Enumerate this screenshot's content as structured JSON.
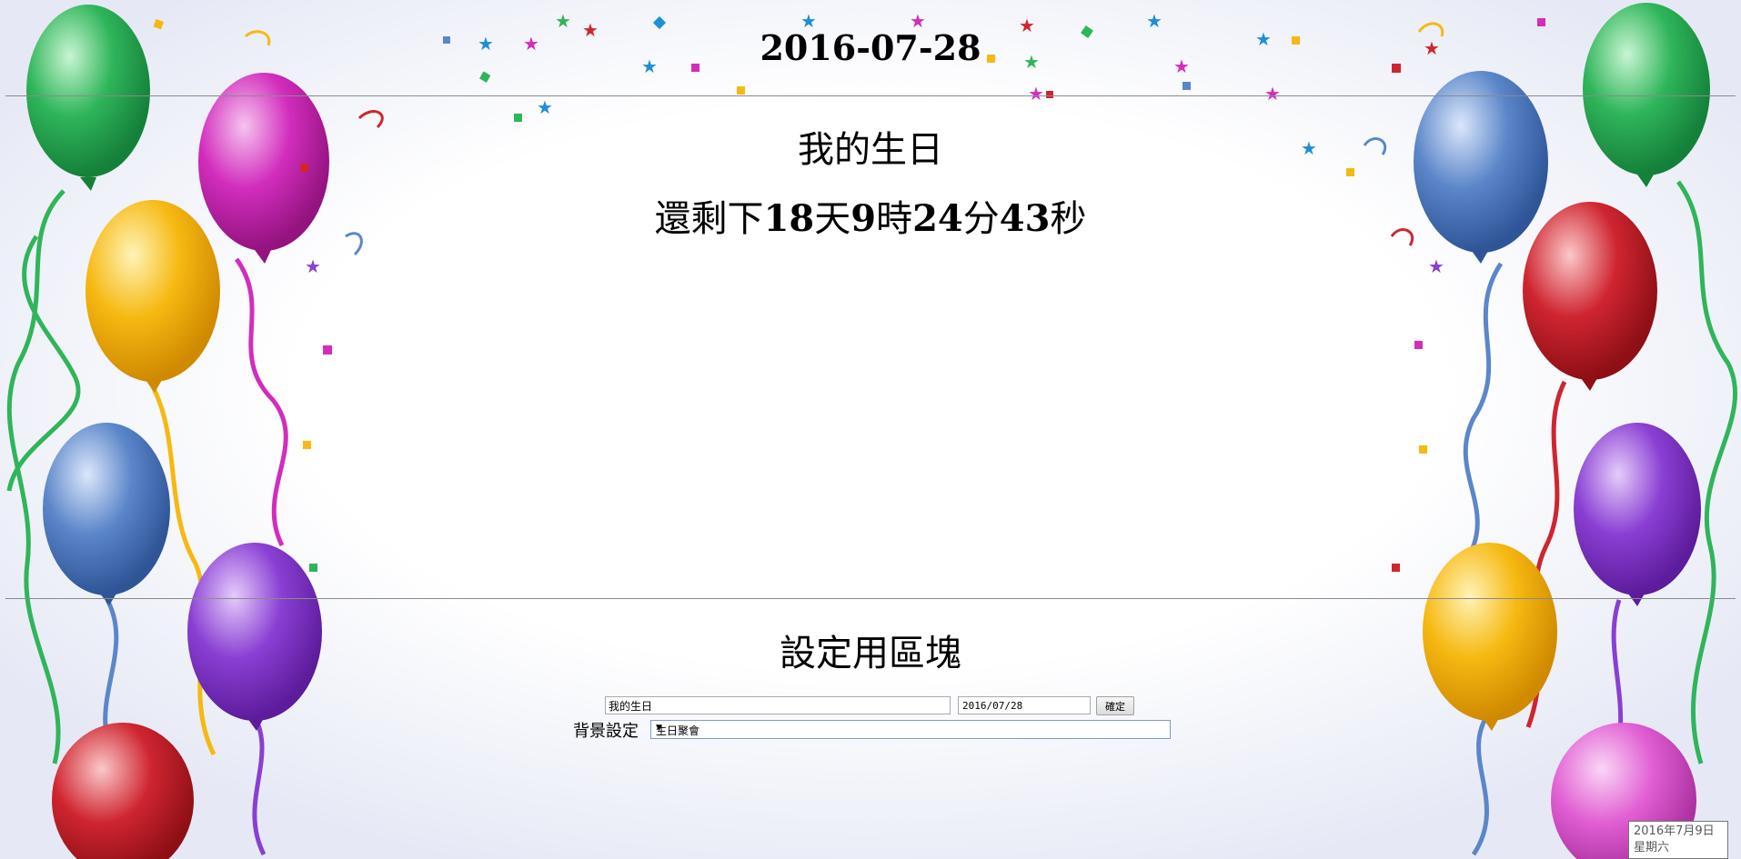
{
  "header": {
    "date": "2016-07-28"
  },
  "event": {
    "title": "我的生日"
  },
  "countdown": {
    "prefix": "還剩下",
    "days": "18",
    "days_unit": "天",
    "hours": "9",
    "hours_unit": "時",
    "minutes": "24",
    "minutes_unit": "分",
    "seconds": "43",
    "seconds_unit": "秒"
  },
  "settings": {
    "title": "設定用區塊",
    "name_value": "我的生日",
    "date_value": "2016/07/28",
    "confirm_label": "確定",
    "background_label": "背景設定",
    "background_selected": "生日聚會"
  },
  "tooltip": {
    "line1": "2016年7月9日",
    "line2": "星期六"
  },
  "colors": {
    "green": "#2fb55a",
    "magenta": "#d22dbd",
    "yellow": "#f6b912",
    "blue": "#5b86c9",
    "purple": "#8a3fd3",
    "red": "#cf2530",
    "pink": "#e15fd3"
  }
}
